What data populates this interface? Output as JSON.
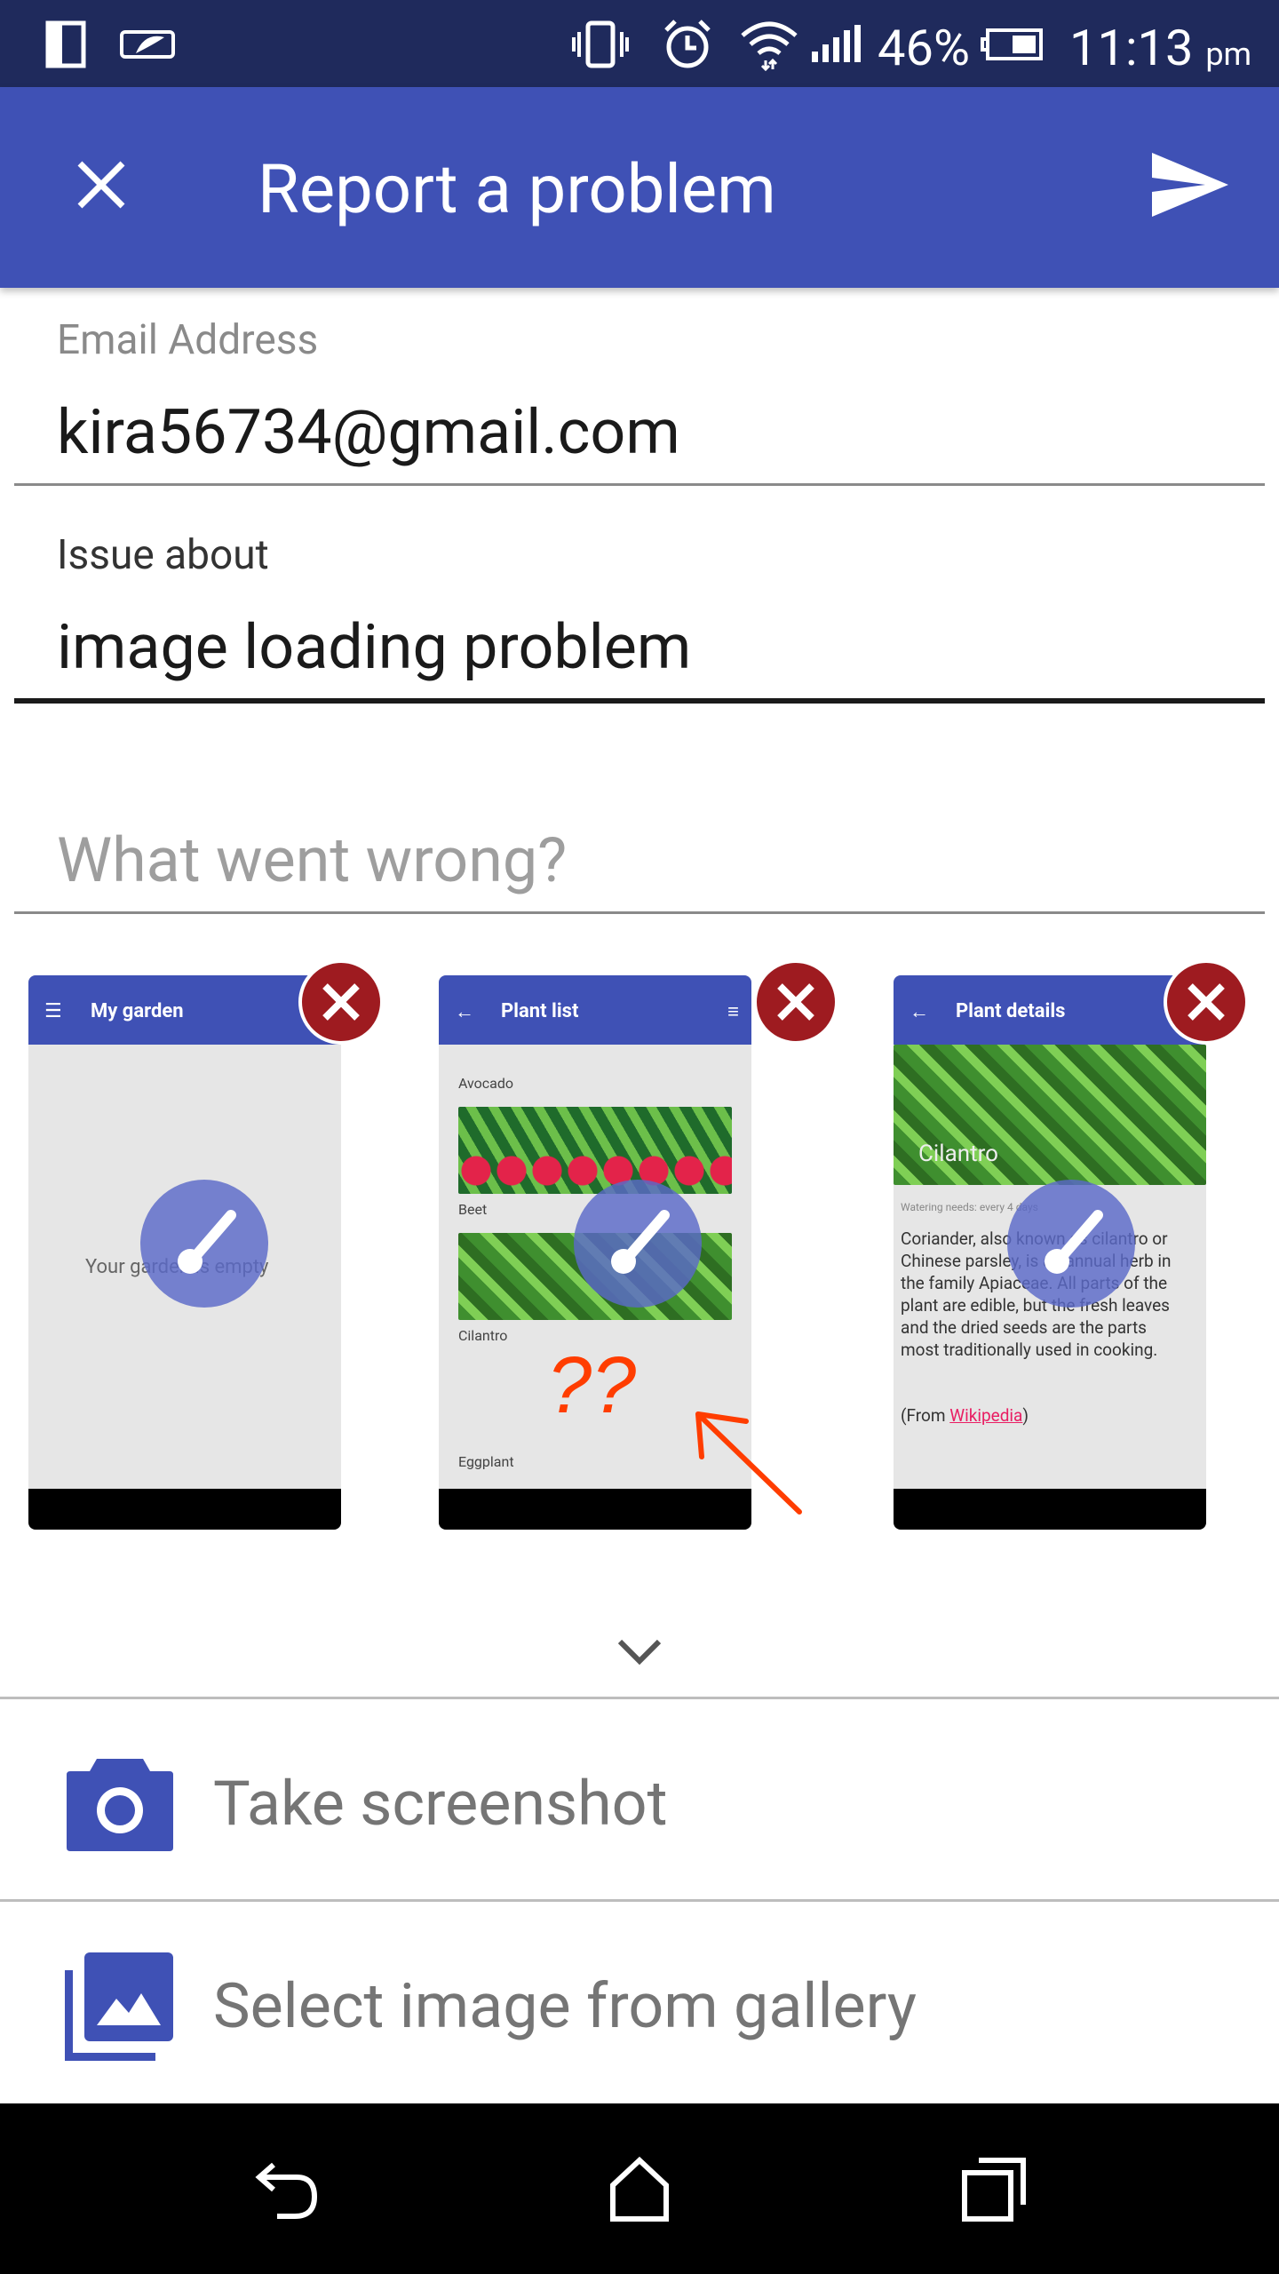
{
  "status_bar": {
    "battery": "46%",
    "time": "11:13",
    "ampm": "pm",
    "icons": [
      "sim-card-icon",
      "battery-saver-icon",
      "vibrate-icon",
      "alarm-icon",
      "wifi-icon",
      "signal-icon",
      "battery-icon"
    ]
  },
  "app_bar": {
    "title": "Report a problem",
    "close_icon": "close-icon",
    "send_icon": "send-icon",
    "color": "#3f51b5"
  },
  "form": {
    "email": {
      "label": "Email Address",
      "value": "kira56734@gmail.com"
    },
    "issue": {
      "label": "Issue about",
      "value": "image loading problem"
    },
    "description": {
      "placeholder": "What went wrong?"
    }
  },
  "screenshots": [
    {
      "title": "My garden",
      "body_text": "Your garden is empty"
    },
    {
      "title": "Plant list",
      "items": [
        "Avocado",
        "Beet",
        "Cilantro",
        "Eggplant"
      ],
      "annotation": "??"
    },
    {
      "title": "Plant details",
      "image_caption": "Cilantro",
      "watering_label": "Watering needs:",
      "watering_value": "every 4 days",
      "description": "Coriander, also known as cilantro or Chinese parsley, is an annual herb in the family Apiaceae. All parts of the plant are edible, but the fresh leaves and the dried seeds are the parts most traditionally used in cooking.",
      "source_prefix": "(From ",
      "source_link": "Wikipedia",
      "source_suffix": ")"
    }
  ],
  "actions": {
    "take_screenshot": "Take screenshot",
    "select_gallery": "Select image from gallery"
  },
  "colors": {
    "status_bar": "#1f2a5c",
    "accent": "#3f51b5",
    "remove": "#9e1b20",
    "annotation": "#ff3d00"
  }
}
